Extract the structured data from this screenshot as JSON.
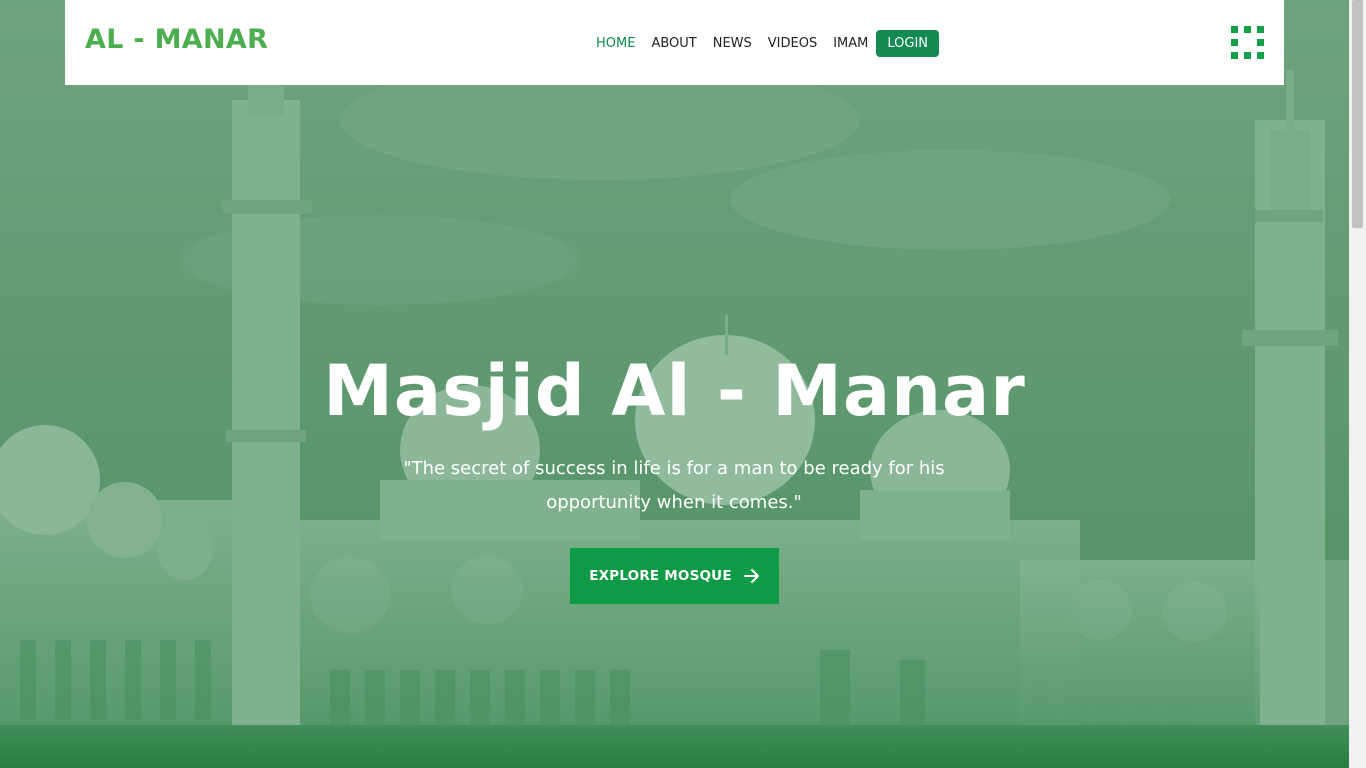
{
  "brand": {
    "name": "AL - MANAR"
  },
  "nav": {
    "items": [
      {
        "label": "HOME",
        "active": true
      },
      {
        "label": "ABOUT",
        "active": false
      },
      {
        "label": "NEWS",
        "active": false
      },
      {
        "label": "VIDEOS",
        "active": false
      },
      {
        "label": "IMAM",
        "active": false
      }
    ],
    "login_label": "LOGIN",
    "menu_icon": "grid-menu-icon"
  },
  "hero": {
    "title": "Masjid Al - Manar",
    "quote": "\"The secret of success in life is for a man to be ready for his opportunity when it comes.\"",
    "cta_label": "EXPLORE MOSQUE",
    "cta_icon": "arrow-right-icon",
    "background": "mosque-photo-green-overlay"
  },
  "colors": {
    "brand_green": "#4cae4f",
    "active_nav": "#0f8a4f",
    "login_bg": "#128a52",
    "cta_bg": "#0f9a45",
    "overlay": "#2f7f49"
  }
}
